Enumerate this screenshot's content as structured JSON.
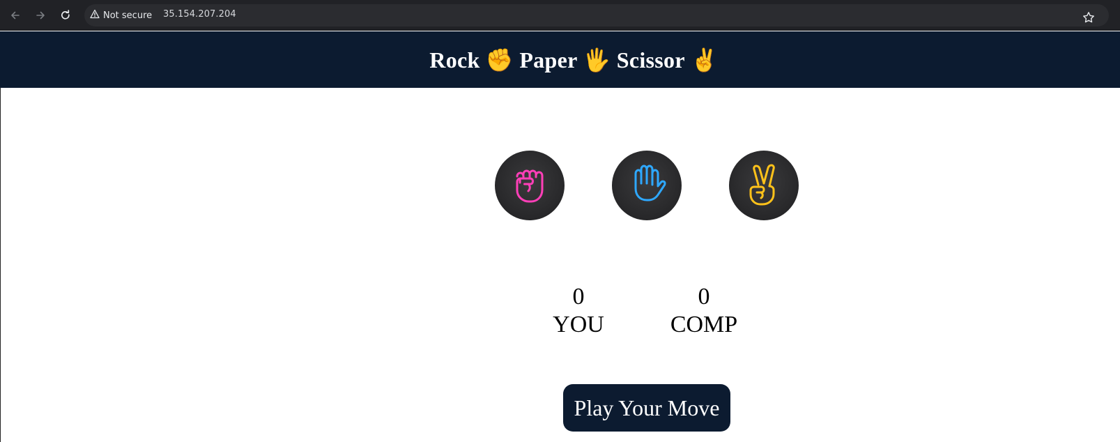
{
  "browser": {
    "security_label": "Not secure",
    "url": "35.154.207.204",
    "icons": {
      "back": "arrow-left-icon",
      "forward": "arrow-right-icon",
      "reload": "reload-icon",
      "warning": "warning-triangle-icon",
      "bookmark": "star-icon"
    }
  },
  "header": {
    "title": "Rock ✊ Paper 🖐 Scissor ✌"
  },
  "choices": [
    {
      "id": "rock",
      "icon": "fist-icon",
      "color": "#ff3fb8"
    },
    {
      "id": "paper",
      "icon": "open-hand-icon",
      "color": "#2ea8ff"
    },
    {
      "id": "scissor",
      "icon": "victory-hand-icon",
      "color": "#ffc21a"
    }
  ],
  "scoreboard": {
    "user": {
      "score": "0",
      "label": "YOU"
    },
    "comp": {
      "score": "0",
      "label": "COMP"
    }
  },
  "actions": {
    "play_label": "Play Your Move"
  },
  "colors": {
    "header_bg": "#0c1b30",
    "browser_bg": "#212226"
  }
}
